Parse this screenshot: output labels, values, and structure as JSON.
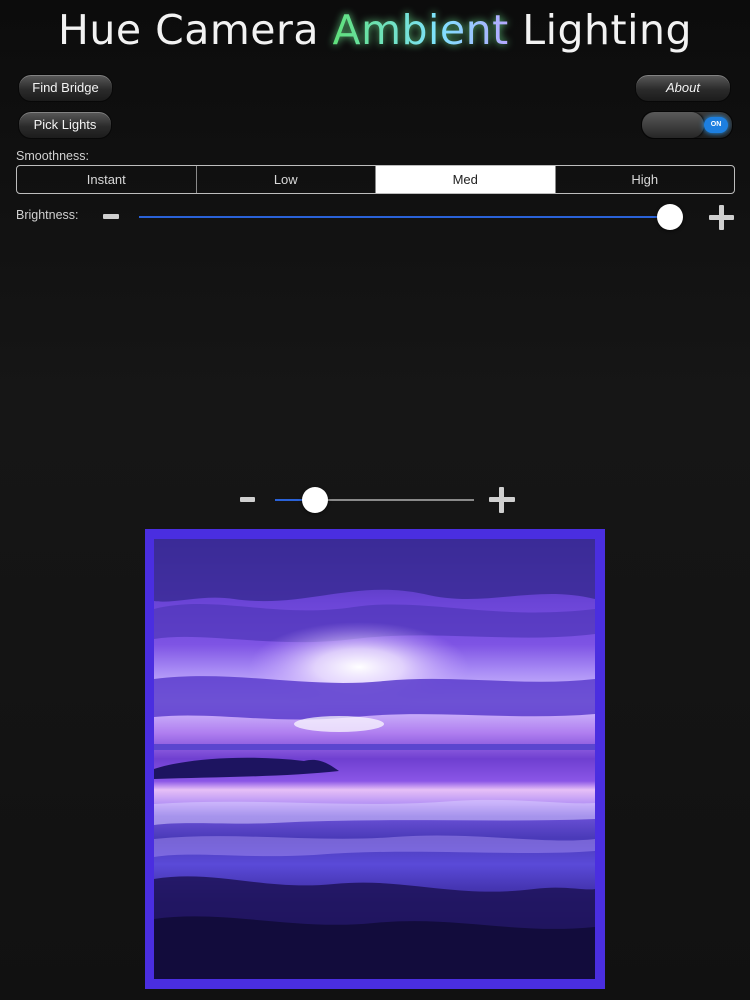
{
  "title": {
    "prefix": "Hue Camera ",
    "highlight": "Ambient",
    "suffix": " Lighting"
  },
  "buttons": {
    "find_bridge": "Find Bridge",
    "pick_lights": "Pick Lights",
    "about": "About"
  },
  "toggle": {
    "state_label": "ON",
    "is_on": true
  },
  "smoothness": {
    "label": "Smoothness:",
    "options": [
      "Instant",
      "Low",
      "Med",
      "High"
    ],
    "selected": "Med"
  },
  "brightness": {
    "label": "Brightness:",
    "minus": "-",
    "plus": "+",
    "value_fraction": 0.98
  },
  "camera_zoom": {
    "minus": "-",
    "plus": "+",
    "value_fraction": 0.2
  },
  "colors": {
    "accent": "#2a62d8",
    "toggle_on": "#1d7fe0",
    "photo_frame": "#4a2ee0"
  },
  "icons": {
    "minus": "minus-icon",
    "plus": "plus-icon"
  }
}
